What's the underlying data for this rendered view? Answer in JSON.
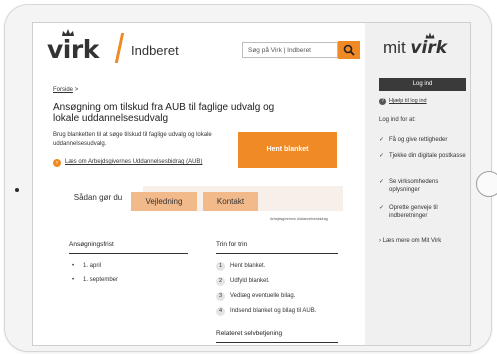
{
  "header": {
    "logo": "virk",
    "subtitle": "Indberet",
    "search_placeholder": "Søg på Virk | Indberet"
  },
  "breadcrumb": {
    "home": "Forside",
    "separator": ">"
  },
  "page": {
    "title": "Ansøgning om tilskud fra AUB til faglige udvalg og lokale uddannelsesudvalg",
    "intro": "Brug blanketten til at søge tilskud til faglige udvalg og lokale uddannelsesudvalg.",
    "aub_link": "Læs om Arbejdsgivernes Uddannelsesbidrag (AUB)",
    "hent_button": "Hent blanket"
  },
  "tabs": [
    {
      "label": "Sådan gør du",
      "active": true
    },
    {
      "label": "Vejledning",
      "active": false
    },
    {
      "label": "Kontakt",
      "active": false
    }
  ],
  "panel": {
    "org_name": "Arbejdsgivernes Uddannelsesbidrag",
    "frist_title": "Ansøgningsfrist",
    "frist_items": [
      "1. april",
      "1. september"
    ],
    "steps_title": "Trin for trin",
    "steps": [
      {
        "num": "1",
        "text": "Hent blanket."
      },
      {
        "num": "2",
        "text": "Udfyld blanket."
      },
      {
        "num": "3",
        "text": "Vedlæg eventuelle bilag."
      },
      {
        "num": "4",
        "text": "Indsend blanket og bilag til AUB."
      }
    ],
    "related_title": "Relateret selvbetjening"
  },
  "sidebar": {
    "logo_prefix": "mit",
    "logo_virk": "virk",
    "login_button": "Log ind",
    "help_link": "Hjælp til log ind",
    "login_for": "Log ind for at:",
    "benefits": [
      "Få og give rettigheder",
      "Tjekke din digitale postkasse",
      "Se virksomhedens oplysninger",
      "Oprette genveje til indberetninger"
    ],
    "more_link": "Læs mere om Mit Virk"
  },
  "colors": {
    "accent": "#f08a24",
    "accent_light": "#f2b98a",
    "dark": "#3a3a3a",
    "sidebar_bg": "#f0f0f0"
  }
}
